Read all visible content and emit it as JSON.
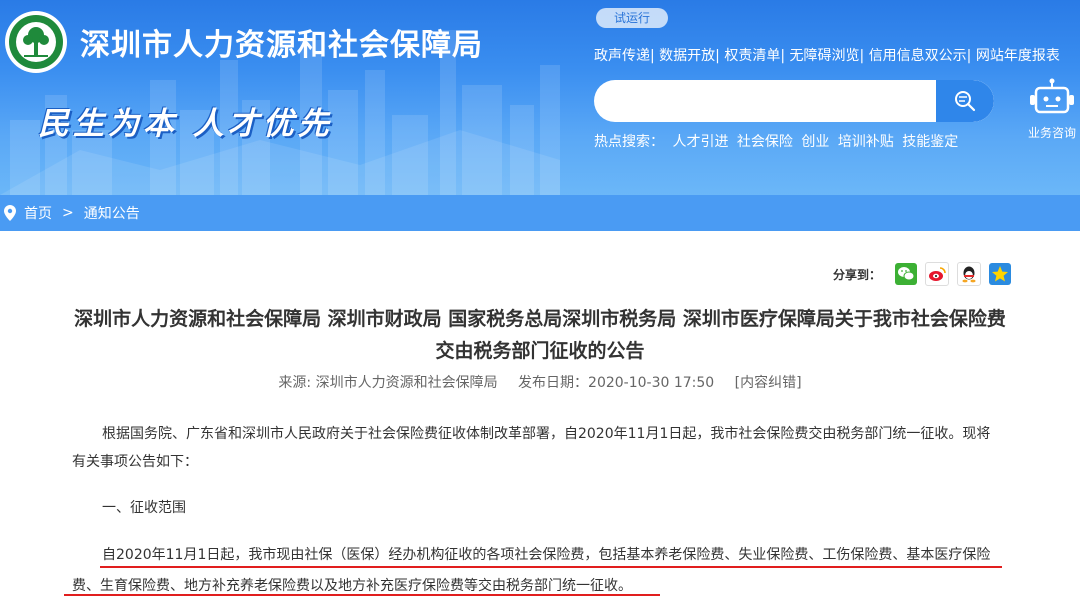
{
  "header": {
    "site_title": "深圳市人力资源和社会保障局",
    "slogan": "民生为本 人才优先",
    "trial_badge": "试运行",
    "top_links": [
      "政声传递|",
      "数据开放|",
      "权责清单|",
      "无障碍浏览|",
      "信用信息双公示|",
      "网站年度报表"
    ],
    "search": {
      "placeholder": ""
    },
    "robot_label": "业务咨询",
    "hot_label": "热点搜索：",
    "hot_items": [
      "人才引进",
      "社会保险",
      "创业",
      "培训补贴",
      "技能鉴定"
    ]
  },
  "breadcrumb": {
    "home": "首页",
    "sep": ">",
    "current": "通知公告"
  },
  "share": {
    "label": "分享到：",
    "icons": [
      "wechat-icon",
      "weibo-icon",
      "qq-icon",
      "qzone-icon"
    ]
  },
  "article": {
    "title": "深圳市人力资源和社会保障局 深圳市财政局 国家税务总局深圳市税务局 深圳市医疗保障局关于我市社会保险费交由税务部门征收的公告",
    "source": "来源: 深圳市人力资源和社会保障局",
    "date": "发布日期：2020-10-30 17:50",
    "correction": "[内容纠错]",
    "paragraphs": [
      "根据国务院、广东省和深圳市人民政府关于社会保险费征收体制改革部署，自2020年11月1日起，我市社会保险费交由税务部门统一征收。现将有关事项公告如下：",
      "一、征收范围",
      "自2020年11月1日起，我市现由社保（医保）经办机构征收的各项社会保险费，包括基本养老保险费、失业保险费、工伤保险费、基本医疗保险费、生育保险费、地方补充养老保险费以及地方补充医疗保险费等交由税务部门统一征收。"
    ]
  },
  "colors": {
    "header_blue": "#3a8ef0",
    "crumb_blue": "#4a9bf3",
    "underline_red": "#e11e1e"
  }
}
